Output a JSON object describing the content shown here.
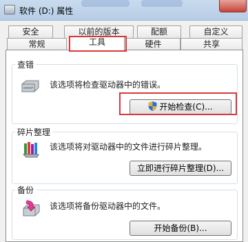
{
  "window": {
    "title": "软件 (D:) 属性"
  },
  "tabs_row1": [
    {
      "label": "安全"
    },
    {
      "label": "以前的版本"
    },
    {
      "label": "配额"
    },
    {
      "label": "自定义"
    }
  ],
  "tabs_row2": [
    {
      "label": "常规"
    },
    {
      "label": "工具",
      "active": true
    },
    {
      "label": "硬件"
    },
    {
      "label": "共享"
    }
  ],
  "sections": {
    "error_check": {
      "title": "查错",
      "desc": "该选项将检查驱动器中的错误。",
      "button": "开始检查(C)..."
    },
    "defrag": {
      "title": "碎片整理",
      "desc": "该选项将对驱动器中的文件进行碎片整理。",
      "button": "立即进行碎片整理(D)..."
    },
    "backup": {
      "title": "备份",
      "desc": "该选项将备份驱动器中的文件。",
      "button": "开始备份(B)..."
    }
  },
  "icons": [
    "drive-icon",
    "shield-icon",
    "defrag-icon",
    "backup-icon",
    "close-icon"
  ],
  "colors": {
    "highlight": "#d9363a",
    "panel": "#ffffff",
    "background": "#f0f0f0"
  }
}
